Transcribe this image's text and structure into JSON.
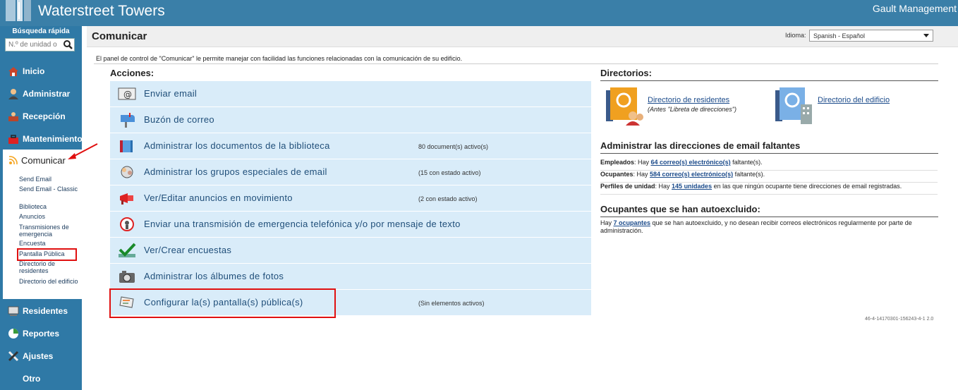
{
  "app": {
    "title": "Waterstreet Towers",
    "company": "Gault Management"
  },
  "sidebar": {
    "quick_search_label": "Búsqueda rápida",
    "quick_search_placeholder": "N.º de unidad o",
    "items": [
      {
        "label": "Inicio",
        "icon": "home-icon"
      },
      {
        "label": "Administrar",
        "icon": "admin-user-icon"
      },
      {
        "label": "Recepción",
        "icon": "reception-icon"
      },
      {
        "label": "Mantenimiento",
        "icon": "toolbox-icon"
      },
      {
        "label": "Comunicar",
        "icon": "broadcast-icon"
      },
      {
        "label": "Residentes",
        "icon": "residents-icon"
      },
      {
        "label": "Reportes",
        "icon": "reports-icon"
      },
      {
        "label": "Ajustes",
        "icon": "tools-icon"
      },
      {
        "label": "Otro"
      }
    ],
    "sub_items": [
      "Send Email",
      "Send Email - Classic",
      "Biblioteca",
      "Anuncios",
      "Transmisiones de emergencia",
      "Encuesta",
      "Pantalla Pública",
      "Directorio de residentes",
      "Directorio del edificio"
    ]
  },
  "header": {
    "title": "Comunicar",
    "language_label": "Idioma:",
    "language_value": "Spanish - Español"
  },
  "intro": "El panel de control de \"Comunicar\" le permite manejar con facilidad las funciones relacionadas con la comunicación de su edificio.",
  "actions": {
    "title": "Acciones:",
    "items": [
      {
        "label": "Enviar email",
        "status": "",
        "icon": "email-icon"
      },
      {
        "label": "Buzón de correo",
        "status": "",
        "icon": "mailbox-icon"
      },
      {
        "label": "Administrar los documentos de la biblioteca",
        "status": "80 document(s) activo(s)",
        "icon": "library-icon"
      },
      {
        "label": "Administrar los grupos especiales de email",
        "status": "(15 con estado activo)",
        "icon": "email-groups-icon"
      },
      {
        "label": "Ver/Editar anuncios en movimiento",
        "status": "(2 con estado activo)",
        "icon": "megaphone-icon"
      },
      {
        "label": "Enviar una transmisión de emergencia telefónica y/o por mensaje de texto",
        "status": "",
        "icon": "emergency-icon"
      },
      {
        "label": "Ver/Crear encuestas",
        "status": "",
        "icon": "checkmark-icon"
      },
      {
        "label": "Administrar los álbumes de fotos",
        "status": "",
        "icon": "camera-icon"
      },
      {
        "label": "Configurar la(s) pantalla(s) pública(s)",
        "status": "(Sin elementos activos)",
        "icon": "public-screen-icon"
      }
    ]
  },
  "directories": {
    "title": "Directorios:",
    "residents": {
      "label": "Directorio de residentes",
      "note": "(Antes \"Libreta de direcciones\")"
    },
    "building": {
      "label": "Directorio del edificio"
    }
  },
  "missing_emails": {
    "title": "Administrar las direcciones de email faltantes",
    "rows": [
      {
        "label": "Empleados",
        "pre": ": Hay ",
        "link": "64 correo(s) electrónico(s)",
        "post": " faltante(s)."
      },
      {
        "label": "Ocupantes",
        "pre": ": Hay ",
        "link": "584 correo(s) electrónico(s)",
        "post": " faltante(s)."
      },
      {
        "label": "Perfiles de unidad",
        "pre": ": Hay ",
        "link": "145 unidades",
        "post": " en las que ningún ocupante tiene direcciones de email registradas."
      }
    ]
  },
  "opted_out": {
    "title": "Ocupantes que se han autoexcluido:",
    "pre": "Hay ",
    "link": "7 ocupantes",
    "post": " que se han autoexcluido, y no desean recibir correos electrónicos regularmente por parte de administración."
  },
  "version": "46-4-14170301-156243-4-1 2.0",
  "colors": {
    "topbar": "#3a7fa8",
    "sidebar": "#2f79a6",
    "action_row": "#d9ecf9",
    "highlight": "#e01010"
  }
}
